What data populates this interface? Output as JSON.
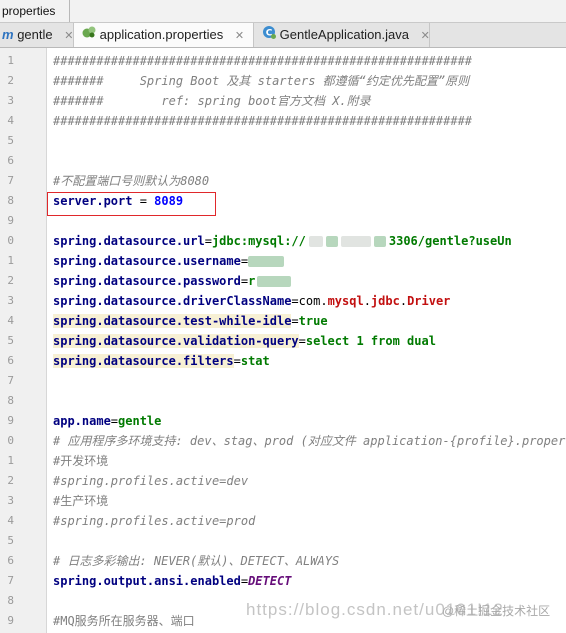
{
  "breadcrumb": {
    "label": "properties"
  },
  "tabs": [
    {
      "label": "gentle",
      "icon": "module-icon"
    },
    {
      "label": "application.properties",
      "icon": "properties-file-icon"
    },
    {
      "label": "GentleApplication.java",
      "icon": "java-class-icon"
    }
  ],
  "tab_close": "✕",
  "gutter": {
    "line_numbers": [
      "1",
      "2",
      "3",
      "4",
      "5",
      "6",
      "7",
      "8",
      "9",
      "0",
      "1",
      "2",
      "3",
      "4",
      "5",
      "6",
      "7",
      "8",
      "9",
      "0",
      "1",
      "2",
      "3",
      "4",
      "5",
      "6",
      "7",
      "8",
      "9"
    ]
  },
  "code": {
    "hash_line": "##########################################################",
    "hdr1_prefix": "#######     ",
    "hdr1_text": "Spring Boot 及其 starters 都遵循“约定优先配置”原则",
    "hdr2_prefix": "#######        ",
    "hdr2_text": "ref: spring boot官方文档 X.附录",
    "comment_port": "#不配置端口号则默认为8080",
    "port_key": "server.port",
    "port_eq": " = ",
    "port_val": "8089",
    "url_key": "spring.datasource.url",
    "url_val_a": "jdbc:mysql://",
    "url_val_b": "3306/gentle?useUn",
    "user_key": "spring.datasource.username",
    "pass_key": "spring.datasource.password",
    "pass_val": "r",
    "driver_key": "spring.datasource.driverClassName",
    "driver_val_a": "com.",
    "driver_val_b": "mysql",
    "driver_val_c": ".",
    "driver_val_d": "jdbc",
    "driver_val_e": ".",
    "driver_val_f": "Driver",
    "idle_key": "spring.datasource.test-while-idle",
    "idle_val": "true",
    "vq_key": "spring.datasource.validation-query",
    "vq_val": "select 1 from dual",
    "filters_key": "spring.datasource.filters",
    "filters_val": "stat",
    "app_key": "app.name",
    "app_val": "gentle",
    "comment_profiles": "# 应用程序多环境支持: dev、stag、prod (对应文件 application-{profile}.proper",
    "comment_dev": "#开发环境",
    "comment_active_dev": "#spring.profiles.active=dev",
    "comment_prod": "#生产环境",
    "comment_active_prod": "#spring.profiles.active=prod",
    "comment_log": "# 日志多彩输出: NEVER(默认)、DETECT、ALWAYS",
    "ansi_key": "spring.output.ansi.enabled",
    "ansi_val": "DETECT",
    "comment_mq": "#MQ服务所在服务器、端口"
  },
  "equals": "=",
  "watermark": {
    "url": "https://blog.csdn.net/u0101!12",
    "site": "@稀土掘金技术社区"
  }
}
